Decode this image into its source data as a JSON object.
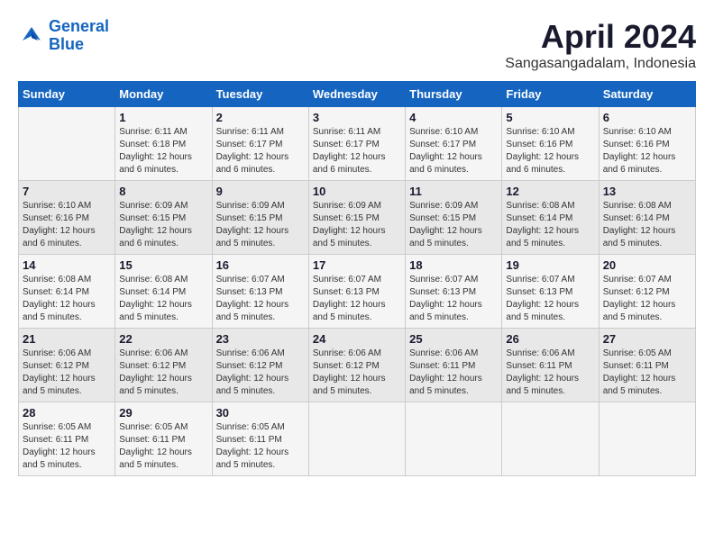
{
  "header": {
    "logo_line1": "General",
    "logo_line2": "Blue",
    "month_year": "April 2024",
    "location": "Sangasangadalam, Indonesia"
  },
  "columns": [
    "Sunday",
    "Monday",
    "Tuesday",
    "Wednesday",
    "Thursday",
    "Friday",
    "Saturday"
  ],
  "weeks": [
    [
      {
        "day": "",
        "info": ""
      },
      {
        "day": "1",
        "info": "Sunrise: 6:11 AM\nSunset: 6:18 PM\nDaylight: 12 hours\nand 6 minutes."
      },
      {
        "day": "2",
        "info": "Sunrise: 6:11 AM\nSunset: 6:17 PM\nDaylight: 12 hours\nand 6 minutes."
      },
      {
        "day": "3",
        "info": "Sunrise: 6:11 AM\nSunset: 6:17 PM\nDaylight: 12 hours\nand 6 minutes."
      },
      {
        "day": "4",
        "info": "Sunrise: 6:10 AM\nSunset: 6:17 PM\nDaylight: 12 hours\nand 6 minutes."
      },
      {
        "day": "5",
        "info": "Sunrise: 6:10 AM\nSunset: 6:16 PM\nDaylight: 12 hours\nand 6 minutes."
      },
      {
        "day": "6",
        "info": "Sunrise: 6:10 AM\nSunset: 6:16 PM\nDaylight: 12 hours\nand 6 minutes."
      }
    ],
    [
      {
        "day": "7",
        "info": "Sunrise: 6:10 AM\nSunset: 6:16 PM\nDaylight: 12 hours\nand 6 minutes."
      },
      {
        "day": "8",
        "info": "Sunrise: 6:09 AM\nSunset: 6:15 PM\nDaylight: 12 hours\nand 6 minutes."
      },
      {
        "day": "9",
        "info": "Sunrise: 6:09 AM\nSunset: 6:15 PM\nDaylight: 12 hours\nand 5 minutes."
      },
      {
        "day": "10",
        "info": "Sunrise: 6:09 AM\nSunset: 6:15 PM\nDaylight: 12 hours\nand 5 minutes."
      },
      {
        "day": "11",
        "info": "Sunrise: 6:09 AM\nSunset: 6:15 PM\nDaylight: 12 hours\nand 5 minutes."
      },
      {
        "day": "12",
        "info": "Sunrise: 6:08 AM\nSunset: 6:14 PM\nDaylight: 12 hours\nand 5 minutes."
      },
      {
        "day": "13",
        "info": "Sunrise: 6:08 AM\nSunset: 6:14 PM\nDaylight: 12 hours\nand 5 minutes."
      }
    ],
    [
      {
        "day": "14",
        "info": "Sunrise: 6:08 AM\nSunset: 6:14 PM\nDaylight: 12 hours\nand 5 minutes."
      },
      {
        "day": "15",
        "info": "Sunrise: 6:08 AM\nSunset: 6:14 PM\nDaylight: 12 hours\nand 5 minutes."
      },
      {
        "day": "16",
        "info": "Sunrise: 6:07 AM\nSunset: 6:13 PM\nDaylight: 12 hours\nand 5 minutes."
      },
      {
        "day": "17",
        "info": "Sunrise: 6:07 AM\nSunset: 6:13 PM\nDaylight: 12 hours\nand 5 minutes."
      },
      {
        "day": "18",
        "info": "Sunrise: 6:07 AM\nSunset: 6:13 PM\nDaylight: 12 hours\nand 5 minutes."
      },
      {
        "day": "19",
        "info": "Sunrise: 6:07 AM\nSunset: 6:13 PM\nDaylight: 12 hours\nand 5 minutes."
      },
      {
        "day": "20",
        "info": "Sunrise: 6:07 AM\nSunset: 6:12 PM\nDaylight: 12 hours\nand 5 minutes."
      }
    ],
    [
      {
        "day": "21",
        "info": "Sunrise: 6:06 AM\nSunset: 6:12 PM\nDaylight: 12 hours\nand 5 minutes."
      },
      {
        "day": "22",
        "info": "Sunrise: 6:06 AM\nSunset: 6:12 PM\nDaylight: 12 hours\nand 5 minutes."
      },
      {
        "day": "23",
        "info": "Sunrise: 6:06 AM\nSunset: 6:12 PM\nDaylight: 12 hours\nand 5 minutes."
      },
      {
        "day": "24",
        "info": "Sunrise: 6:06 AM\nSunset: 6:12 PM\nDaylight: 12 hours\nand 5 minutes."
      },
      {
        "day": "25",
        "info": "Sunrise: 6:06 AM\nSunset: 6:11 PM\nDaylight: 12 hours\nand 5 minutes."
      },
      {
        "day": "26",
        "info": "Sunrise: 6:06 AM\nSunset: 6:11 PM\nDaylight: 12 hours\nand 5 minutes."
      },
      {
        "day": "27",
        "info": "Sunrise: 6:05 AM\nSunset: 6:11 PM\nDaylight: 12 hours\nand 5 minutes."
      }
    ],
    [
      {
        "day": "28",
        "info": "Sunrise: 6:05 AM\nSunset: 6:11 PM\nDaylight: 12 hours\nand 5 minutes."
      },
      {
        "day": "29",
        "info": "Sunrise: 6:05 AM\nSunset: 6:11 PM\nDaylight: 12 hours\nand 5 minutes."
      },
      {
        "day": "30",
        "info": "Sunrise: 6:05 AM\nSunset: 6:11 PM\nDaylight: 12 hours\nand 5 minutes."
      },
      {
        "day": "",
        "info": ""
      },
      {
        "day": "",
        "info": ""
      },
      {
        "day": "",
        "info": ""
      },
      {
        "day": "",
        "info": ""
      }
    ]
  ]
}
